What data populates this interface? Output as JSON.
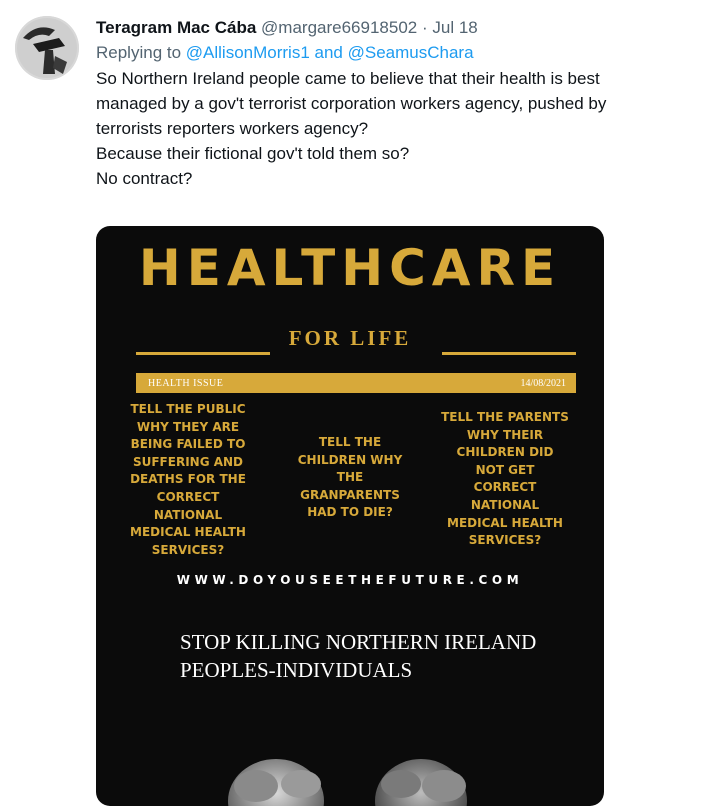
{
  "tweet": {
    "display_name": "Teragram Mac Cába",
    "handle": "@margare66918502",
    "separator": "·",
    "date": "Jul 18",
    "reply_prefix": "Replying to ",
    "reply_mention_1": "@AllisonMorris1",
    "reply_and": " and ",
    "reply_mention_2": "@SeamusChara",
    "body_lines": [
      "So Northern Ireland people came to believe that their health is best",
      "managed by a gov't terrorist corporation workers agency, pushed by",
      "terrorists reporters workers agency?",
      "Because their fictional gov't told them so?",
      "No contract?"
    ]
  },
  "poster": {
    "title": "HEALTHCARE",
    "subtitle": "FOR LIFE",
    "issue_label": "HEALTH  ISSUE",
    "issue_date": "14/08/2021",
    "column_1": [
      "TELL THE PUBLIC",
      "WHY THEY ARE",
      "BEING FAILED TO",
      "SUFFERING AND",
      "DEATHS FOR THE",
      "CORRECT",
      "NATIONAL",
      "MEDICAL HEALTH",
      "SERVICES?"
    ],
    "column_2": [
      "TELL THE",
      "CHILDREN WHY",
      "THE",
      "GRANPARENTS",
      "HAD TO DIE?"
    ],
    "column_3": [
      "TELL THE PARENTS",
      "WHY THEIR",
      "CHILDREN DID",
      "NOT GET",
      "CORRECT",
      "NATIONAL",
      "MEDICAL HEALTH",
      "SERVICES?"
    ],
    "website": "WWW.DOYOUSEETHEFUTURE.COM",
    "headline_lines": [
      "STOP KILLING NORTHERN IRELAND",
      "PEOPLES-INDIVIDUALS"
    ],
    "accent_color": "#d7a93a",
    "background_color": "#0b0b0b"
  },
  "colors": {
    "link": "#1d9bf0",
    "secondary_text": "#536471",
    "primary_text": "#0f1419"
  }
}
